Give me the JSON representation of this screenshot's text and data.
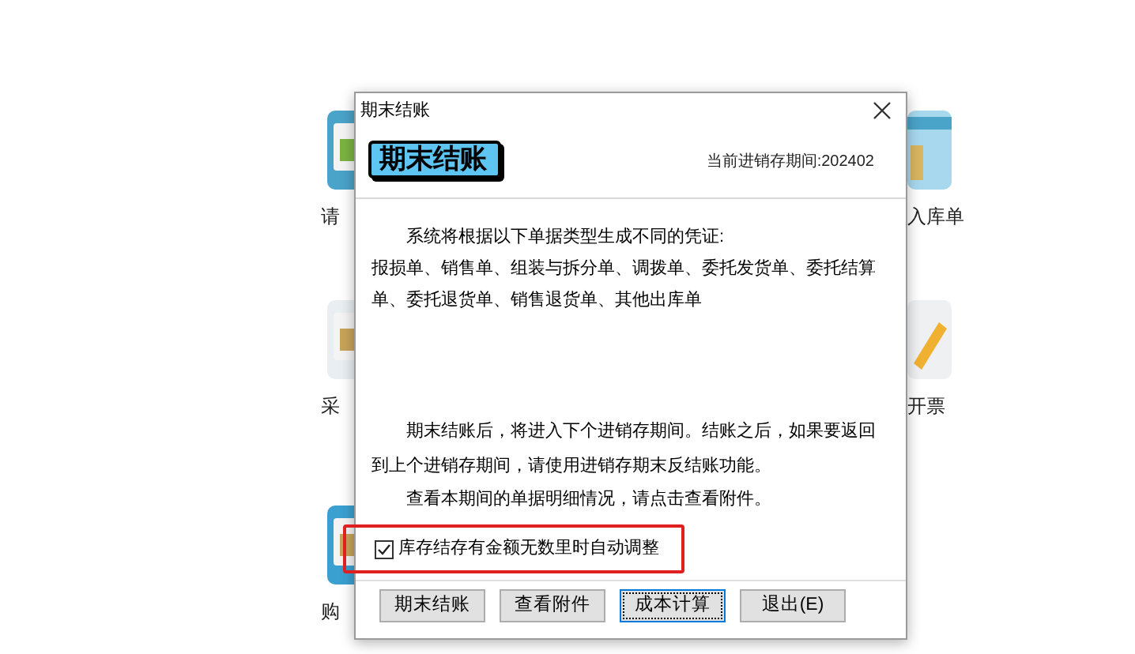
{
  "background": {
    "left_items": [
      {
        "label": "请"
      },
      {
        "label": "采"
      },
      {
        "label": "购"
      }
    ],
    "right_items": [
      {
        "label": "入库单"
      },
      {
        "label": "开票"
      }
    ]
  },
  "dialog": {
    "title": "期末结账",
    "heading": "期末结账",
    "period": "当前进销存期间:202402",
    "paragraphs": [
      {
        "kind": "indent",
        "text": "系统将根据以下单据类型生成不同的凭证:"
      },
      {
        "kind": "plain",
        "text": "报损单、销售单、组装与拆分单、调拨单、委托发货单、委托结算单、委托退货单、销售退货单、其他出库单"
      },
      {
        "kind": "gap",
        "text": "期末结账后，将进入下个进销存期间。结账之后，如果要返回到上个进销存期间，请使用进销存期末反结账功能。"
      },
      {
        "kind": "indent",
        "text": "查看本期间的单据明细情况，请点击查看附件。"
      }
    ],
    "checkbox": {
      "label": "库存结存有金额无数里时自动调整",
      "checked": true
    },
    "buttons": [
      {
        "label": "期末结账",
        "focused": false
      },
      {
        "label": "查看附件",
        "focused": false
      },
      {
        "label": "成本计算",
        "focused": true
      },
      {
        "label": "退出(E)",
        "focused": false
      }
    ]
  }
}
